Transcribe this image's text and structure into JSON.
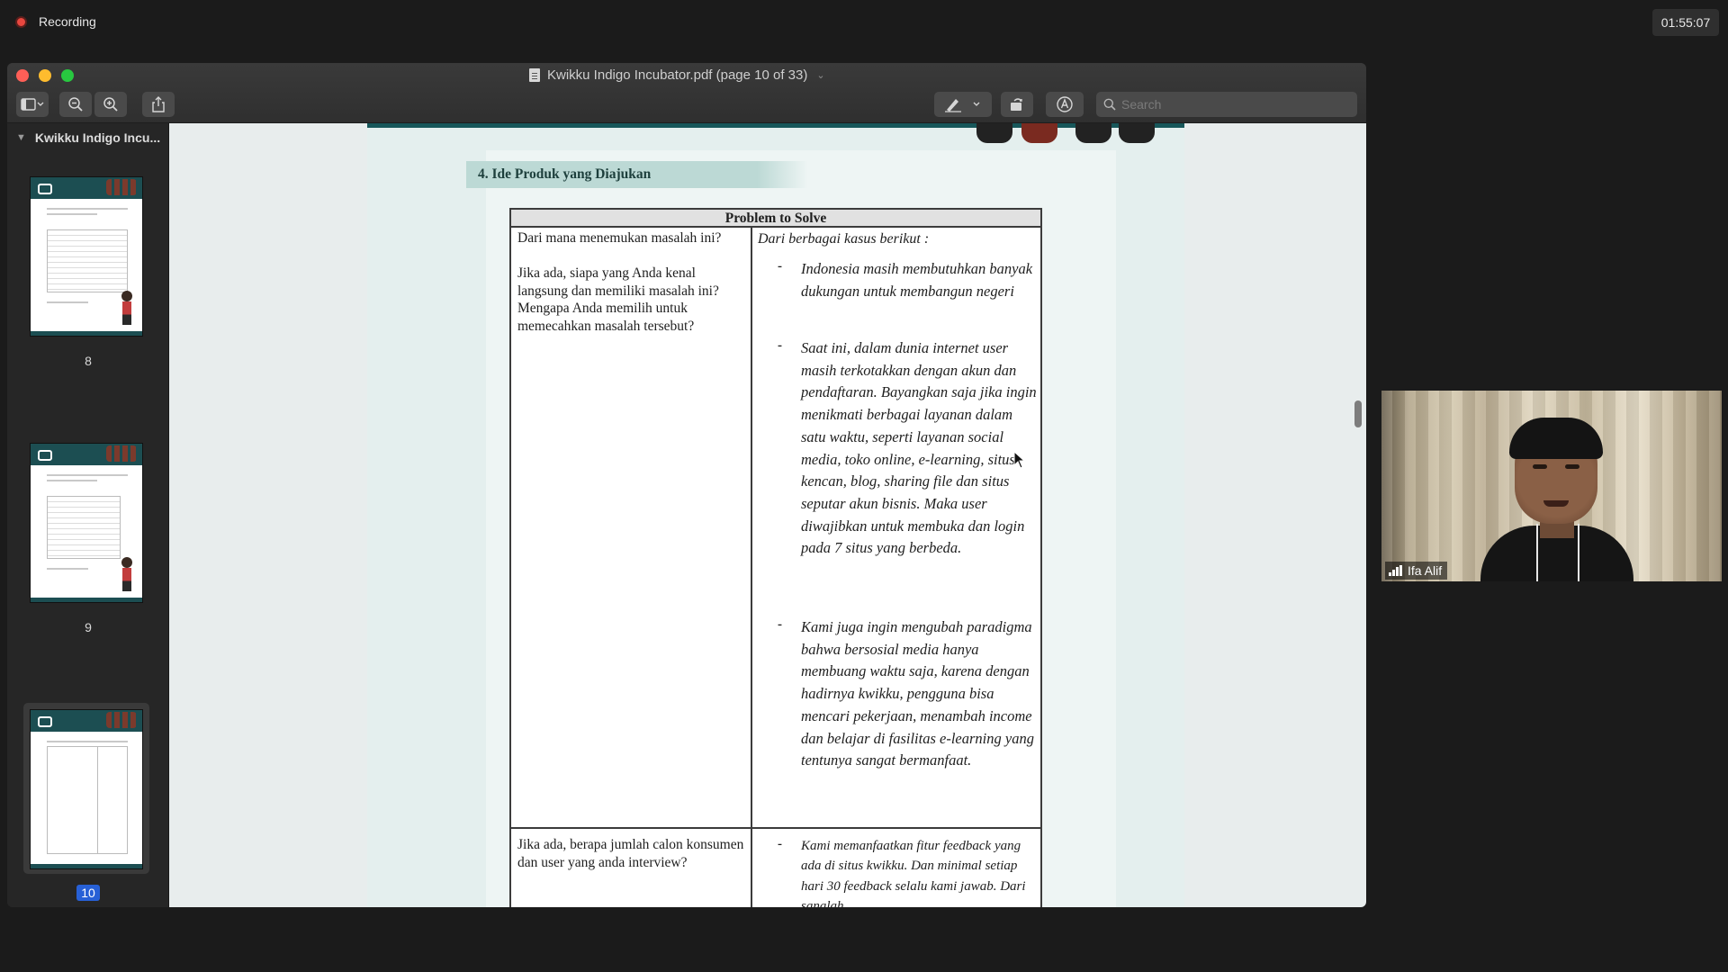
{
  "recording": {
    "label": "Recording",
    "clock": "01:55:07"
  },
  "window": {
    "title": "Kwikku Indigo Incubator.pdf (page 10 of 33)",
    "search_placeholder": "Search"
  },
  "sidebar": {
    "header": "Kwikku Indigo Incu...",
    "pages": [
      {
        "number": "8",
        "selected": false
      },
      {
        "number": "9",
        "selected": false
      },
      {
        "number": "10",
        "selected": true
      }
    ]
  },
  "document": {
    "section_heading": "4. Ide Produk yang Diajukan",
    "table_header": "Problem to Solve",
    "row1": {
      "question_a": "Dari mana menemukan masalah ini?",
      "question_b": "Jika ada, siapa yang Anda kenal langsung dan memiliki masalah ini? Mengapa Anda memilih untuk memecahkan masalah tersebut?",
      "intro": "Dari berbagai kasus berikut :",
      "bullets": [
        "Indonesia masih membutuhkan banyak dukungan untuk membangun negeri",
        "Saat ini, dalam dunia internet user masih terkotakkan dengan akun dan pendaftaran. Bayangkan saja jika ingin menikmati berbagai layanan dalam satu waktu, seperti layanan social media, toko online, e-learning, situs kencan, blog, sharing file dan situs seputar akun bisnis. Maka user diwajibkan untuk membuka dan login pada 7 situs yang berbeda.",
        "Kami juga ingin mengubah paradigma bahwa bersosial media hanya membuang waktu saja, karena dengan hadirnya kwikku, pengguna bisa mencari pekerjaan, menambah income dan belajar di fasilitas e-learning yang tentunya sangat bermanfaat."
      ]
    },
    "row2": {
      "question": "Jika ada, berapa jumlah calon konsumen dan user yang anda interview?",
      "bullet": "Kami memanfaatkan fitur feedback yang ada di situs kwikku. Dan minimal setiap hari 30 feedback selalu kami jawab. Dari sanalah"
    }
  },
  "video": {
    "participant_name": "Ifa Alif"
  },
  "icons": {
    "sidebar_toggle": "sidebar-icon",
    "zoom_out": "zoom-out-icon",
    "zoom_in": "zoom-in-icon",
    "share": "share-icon",
    "markup": "pen-icon",
    "rotate": "rotate-icon",
    "annotate": "markup-circle-icon",
    "search": "search-icon"
  },
  "colors": {
    "recording_dot": "#e8473f",
    "page_selected": "#2760d6",
    "doc_accent": "#17575a"
  }
}
